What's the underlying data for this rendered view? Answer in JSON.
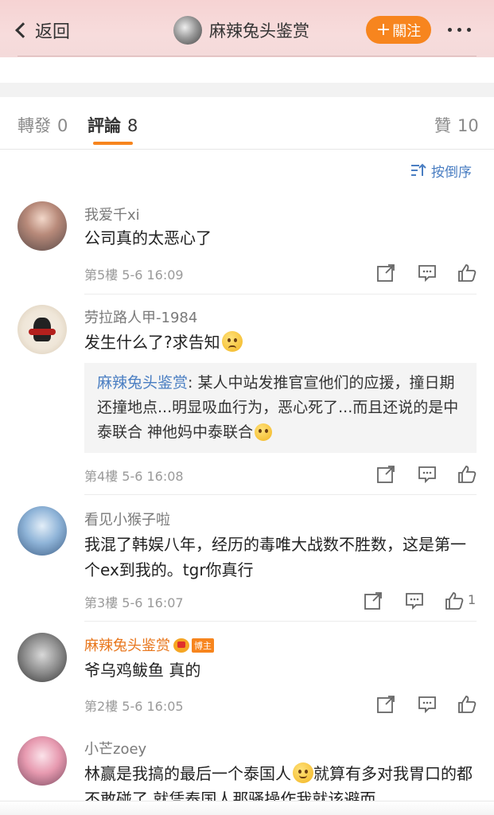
{
  "header": {
    "back_label": "返回",
    "title": "麻辣兔头鉴赏",
    "follow_label": "關注",
    "follow_plus": "+"
  },
  "tabs": {
    "repost": {
      "label": "轉發",
      "count": "0"
    },
    "comments": {
      "label": "評論",
      "count": "8"
    },
    "likes": {
      "label": "贊",
      "count": "10"
    }
  },
  "sort_label": "按倒序",
  "comments": [
    {
      "name": "我爱千xi",
      "text": "公司真的太恶心了",
      "floor": "第5樓",
      "time": "5-6 16:09",
      "likes": ""
    },
    {
      "name": "劳拉路人甲-1984",
      "text": "发生什么了?求告知",
      "floor": "第4樓",
      "time": "5-6 16:08",
      "likes": "",
      "quote": {
        "name": "麻辣兔头鉴赏",
        "sep": ":",
        "text": "某人中站发推官宣他们的应援，撞日期还撞地点...明显吸血行为，恶心死了...而且还说的是中泰联合 神他妈中泰联合"
      }
    },
    {
      "name": "看见小猴子啦",
      "text": "我混了韩娱八年，经历的毒唯大战数不胜数，这是第一个ex到我的。tgr你真行",
      "floor": "第3樓",
      "time": "5-6 16:07",
      "likes": "1"
    },
    {
      "name": "麻辣兔头鉴赏",
      "badge": "博主",
      "text": "爷乌鸡鲅鱼 真的",
      "floor": "第2樓",
      "time": "5-6 16:05",
      "likes": ""
    },
    {
      "name": "小芒zoey",
      "text_part1": "林赢是我搞的最后一个泰国人",
      "text_part2": "就算有多对我胃口的都不敢碰了 就凭泰国人那骚操作我就该避而"
    }
  ],
  "colors": {
    "accent": "#f7851e",
    "link": "#4a7ec2",
    "header_bg": "#f6d3d3"
  }
}
